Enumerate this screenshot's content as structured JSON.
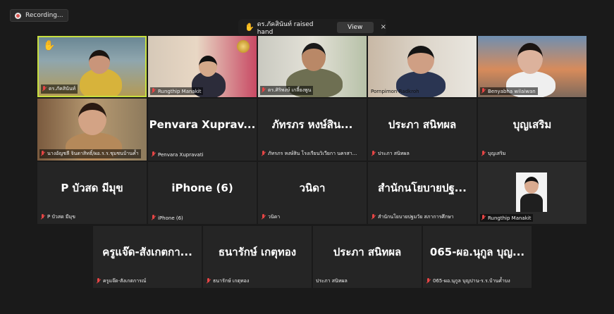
{
  "recording": {
    "label": "Recording..."
  },
  "notification": {
    "text": "ดร.ภัคสินันท์ raised hand",
    "view_label": "View",
    "close_label": "×"
  },
  "tiles": [
    {
      "big": "",
      "label": "ดร.ภัคสินันท์"
    },
    {
      "big": "",
      "label": "Rungthip Manakit"
    },
    {
      "big": "",
      "label": "ดร.ศิริพงษ์ เกลี้ยงพูน"
    },
    {
      "big": "",
      "label": "Pornpimon Radkroh"
    },
    {
      "big": "",
      "label": "Benyabha wilaiwan"
    },
    {
      "big": "",
      "label": "นางอัญชลี จินดาสิทธิ์/ผอ.ร.ร.ชุมชนบ้านค้ำ"
    },
    {
      "big": "Penvara Xuprav...",
      "label": "Penvara Xupravati"
    },
    {
      "big": "ภัทรภร หงษ์สิน...",
      "label": "ภัทรภร หงษ์สิน โรงเรียนวิเวียกา นครสา..."
    },
    {
      "big": "ประภา สนิทผล",
      "label": "ประภา สนิทผล"
    },
    {
      "big": "บุญเสริม",
      "label": "บุญเสริม"
    },
    {
      "big": "P บัวสด มีมุข",
      "label": "P บัวสด มีมุข"
    },
    {
      "big": "iPhone (6)",
      "label": "iPhone (6)"
    },
    {
      "big": "วนิดา",
      "label": "วนิดา"
    },
    {
      "big": "สำนักนโยบายปฐ...",
      "label": "สำนักนโยบายปฐมวัย สภาการศึกษา"
    },
    {
      "big": "",
      "label": "Rungthip Manakit"
    },
    {
      "big": "ครูแจ๊ด-สังเกตกา...",
      "label": "ครูแจ๊ด-สังเกตการณ์"
    },
    {
      "big": "ธนารักษ์ เกตุทอง",
      "label": "ธนารักษ์ เกตุทอง"
    },
    {
      "big": "ประภา สนิทผล",
      "label": "ประภา สนิทผล"
    },
    {
      "big": "065-ผอ.นุกูล บุญ...",
      "label": "065-ผอ.นุกูล บุญปาน-ร.ร.บ้านค้ำบง"
    }
  ]
}
